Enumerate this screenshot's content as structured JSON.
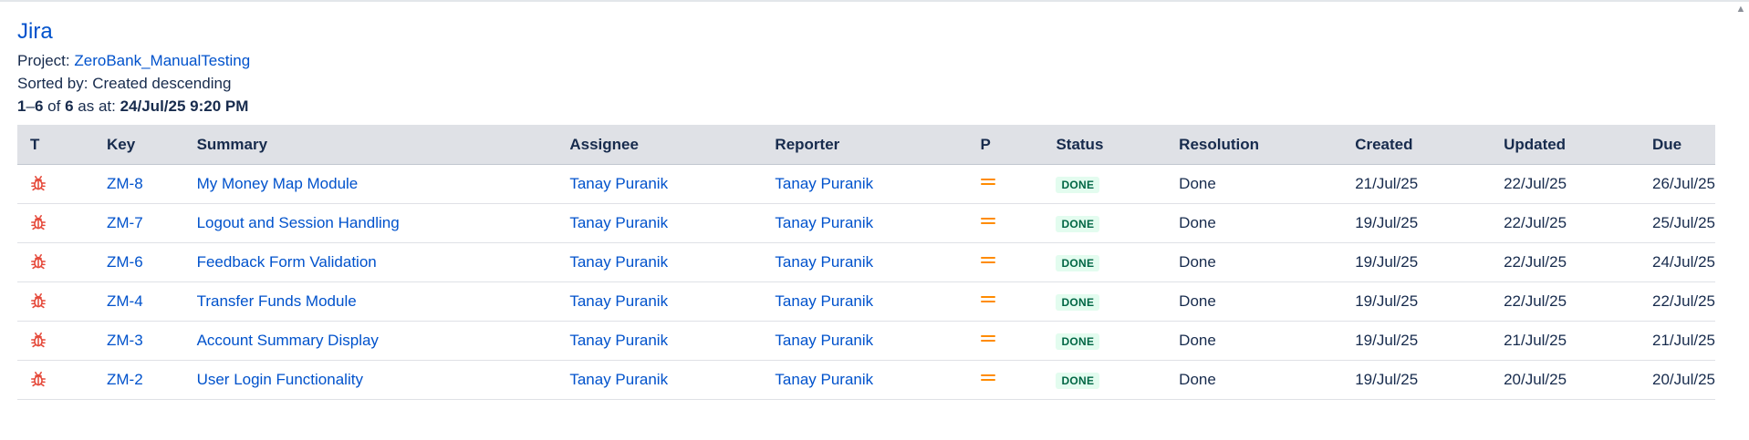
{
  "app_title": "Jira",
  "project": {
    "label": "Project:",
    "name": "ZeroBank_ManualTesting"
  },
  "sort": {
    "label": "Sorted by:",
    "value": "Created descending"
  },
  "range": {
    "from": "1",
    "to": "6",
    "of_text": "of",
    "total": "6",
    "as_at_text": "as at:",
    "timestamp": "24/Jul/25 9:20 PM"
  },
  "columns": [
    "T",
    "Key",
    "Summary",
    "Assignee",
    "Reporter",
    "P",
    "Status",
    "Resolution",
    "Created",
    "Updated",
    "Due"
  ],
  "issues": [
    {
      "type_icon": "bug-icon",
      "key": "ZM-8",
      "summary": "My Money Map Module",
      "assignee": "Tanay Puranik",
      "reporter": "Tanay Puranik",
      "priority_icon": "priority-medium-icon",
      "status": "DONE",
      "resolution": "Done",
      "created": "21/Jul/25",
      "updated": "22/Jul/25",
      "due": "26/Jul/25"
    },
    {
      "type_icon": "bug-icon",
      "key": "ZM-7",
      "summary": "Logout and Session Handling",
      "assignee": "Tanay Puranik",
      "reporter": "Tanay Puranik",
      "priority_icon": "priority-medium-icon",
      "status": "DONE",
      "resolution": "Done",
      "created": "19/Jul/25",
      "updated": "22/Jul/25",
      "due": "25/Jul/25"
    },
    {
      "type_icon": "bug-icon",
      "key": "ZM-6",
      "summary": "Feedback Form Validation",
      "assignee": "Tanay Puranik",
      "reporter": "Tanay Puranik",
      "priority_icon": "priority-medium-icon",
      "status": "DONE",
      "resolution": "Done",
      "created": "19/Jul/25",
      "updated": "22/Jul/25",
      "due": "24/Jul/25"
    },
    {
      "type_icon": "bug-icon",
      "key": "ZM-4",
      "summary": "Transfer Funds Module",
      "assignee": "Tanay Puranik",
      "reporter": "Tanay Puranik",
      "priority_icon": "priority-medium-icon",
      "status": "DONE",
      "resolution": "Done",
      "created": "19/Jul/25",
      "updated": "22/Jul/25",
      "due": "22/Jul/25"
    },
    {
      "type_icon": "bug-icon",
      "key": "ZM-3",
      "summary": "Account Summary Display",
      "assignee": "Tanay Puranik",
      "reporter": "Tanay Puranik",
      "priority_icon": "priority-medium-icon",
      "status": "DONE",
      "resolution": "Done",
      "created": "19/Jul/25",
      "updated": "21/Jul/25",
      "due": "21/Jul/25"
    },
    {
      "type_icon": "bug-icon",
      "key": "ZM-2",
      "summary": "User Login Functionality",
      "assignee": "Tanay Puranik",
      "reporter": "Tanay Puranik",
      "priority_icon": "priority-medium-icon",
      "status": "DONE",
      "resolution": "Done",
      "created": "19/Jul/25",
      "updated": "20/Jul/25",
      "due": "20/Jul/25"
    }
  ],
  "colors": {
    "link": "#0052cc",
    "bug": "#e5493a",
    "priority_medium": "#ff8b00",
    "done_bg": "#e3fcef",
    "done_text": "#006644",
    "header_bg": "#dfe1e6"
  }
}
